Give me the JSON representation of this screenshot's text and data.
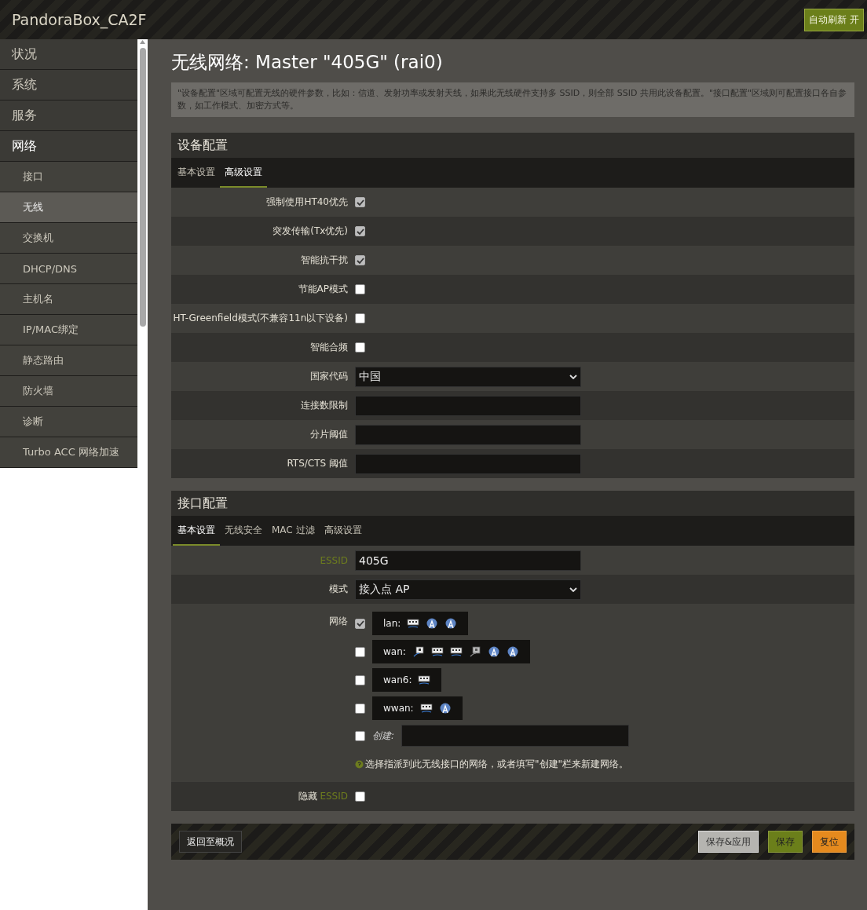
{
  "header": {
    "title": "PandoraBox_CA2F",
    "auto_refresh_button": "自动刷新 开"
  },
  "sidebar": {
    "items": [
      {
        "label": "状况",
        "selected": false
      },
      {
        "label": "系统",
        "selected": false
      },
      {
        "label": "服务",
        "selected": false
      },
      {
        "label": "网络",
        "selected": true,
        "children": [
          {
            "label": "接口",
            "selected": false
          },
          {
            "label": "无线",
            "selected": true
          },
          {
            "label": "交换机",
            "selected": false
          },
          {
            "label": "DHCP/DNS",
            "selected": false
          },
          {
            "label": "主机名",
            "selected": false
          },
          {
            "label": "IP/MAC绑定",
            "selected": false
          },
          {
            "label": "静态路由",
            "selected": false
          },
          {
            "label": "防火墙",
            "selected": false
          },
          {
            "label": "诊断",
            "selected": false
          },
          {
            "label": "Turbo ACC 网络加速",
            "selected": false
          }
        ]
      }
    ]
  },
  "page": {
    "title": "无线网络: Master \"405G\" (rai0)",
    "description": "\"设备配置\"区域可配置无线的硬件参数，比如：信道、发射功率或发射天线，如果此无线硬件支持多 SSID，则全部 SSID 共用此设备配置。\"接口配置\"区域则可配置接口各自参数，如工作模式、加密方式等。"
  },
  "sections": [
    {
      "title": "设备配置",
      "tabs": [
        {
          "label": "基本设置",
          "selected": false
        },
        {
          "label": "高级设置",
          "selected": true
        }
      ],
      "rows": [
        {
          "kind": "checkbox",
          "label": [
            {
              "text": "强制使用HT40优先",
              "accent": false
            }
          ],
          "checked": true
        },
        {
          "kind": "checkbox",
          "label": [
            {
              "text": "突发传输(Tx优先)",
              "accent": false
            }
          ],
          "checked": true
        },
        {
          "kind": "checkbox",
          "label": [
            {
              "text": "智能抗干扰",
              "accent": false
            }
          ],
          "checked": true
        },
        {
          "kind": "checkbox",
          "label": [
            {
              "text": "节能AP模式",
              "accent": false
            }
          ],
          "checked": false
        },
        {
          "kind": "checkbox",
          "label": [
            {
              "text": "HT-Greenfield模式(不兼容11n以下设备)",
              "accent": false
            }
          ],
          "checked": false
        },
        {
          "kind": "checkbox",
          "label": [
            {
              "text": "智能合频",
              "accent": false
            }
          ],
          "checked": false
        },
        {
          "kind": "select",
          "label": [
            {
              "text": "国家代码",
              "accent": false
            }
          ],
          "value": "中国"
        },
        {
          "kind": "text",
          "label": [
            {
              "text": "连接数限制",
              "accent": false
            }
          ]
        },
        {
          "kind": "text",
          "label": [
            {
              "text": "分片阈值",
              "accent": false
            }
          ]
        },
        {
          "kind": "text",
          "label": [
            {
              "text": "RTS/CTS 阈值",
              "accent": false
            }
          ]
        }
      ]
    },
    {
      "title": "接口配置",
      "tabs": [
        {
          "label": "基本设置",
          "selected": true
        },
        {
          "label": "无线安全",
          "selected": false
        },
        {
          "label": "MAC 过滤",
          "selected": false
        },
        {
          "label": "高级设置",
          "selected": false
        }
      ],
      "rows": [
        {
          "kind": "text",
          "label": [
            {
              "text": "ESSID",
              "accent": true
            }
          ],
          "value": "405G"
        },
        {
          "kind": "select",
          "label": [
            {
              "text": "模式",
              "accent": false
            }
          ],
          "value": "接入点 AP"
        },
        {
          "kind": "networks",
          "label": [
            {
              "text": "网络",
              "accent": false
            }
          ],
          "networks": [
            {
              "name": "lan:",
              "checked": true,
              "icons": [
                {
                  "kind": "switch"
                },
                {
                  "kind": "wifi"
                },
                {
                  "kind": "wifi"
                }
              ]
            },
            {
              "name": "wan:",
              "checked": false,
              "icons": [
                {
                  "kind": "port"
                },
                {
                  "kind": "switch"
                },
                {
                  "kind": "switch"
                },
                {
                  "kind": "port_down"
                },
                {
                  "kind": "wifi"
                },
                {
                  "kind": "wifi"
                }
              ]
            },
            {
              "name": "wan6:",
              "checked": false,
              "icons": [
                {
                  "kind": "switch"
                }
              ]
            },
            {
              "name": "wwan:",
              "checked": false,
              "icons": [
                {
                  "kind": "switch"
                },
                {
                  "kind": "wifi"
                }
              ]
            }
          ],
          "create": {
            "checked": false,
            "label": "创建:"
          },
          "hint": "选择指派到此无线接口的网络，或者填写\"创建\"栏来新建网络。"
        },
        {
          "kind": "checkbox",
          "label": [
            {
              "text": "隐藏",
              "accent": false
            },
            {
              "text": "ESSID",
              "accent": true
            }
          ],
          "checked": false
        }
      ]
    }
  ],
  "footer": {
    "back_button": "返回至概况",
    "buttons": [
      {
        "label": "保存&应用",
        "kind": "apply"
      },
      {
        "label": "保存",
        "kind": "save"
      },
      {
        "label": "复位",
        "kind": "reset"
      }
    ]
  }
}
